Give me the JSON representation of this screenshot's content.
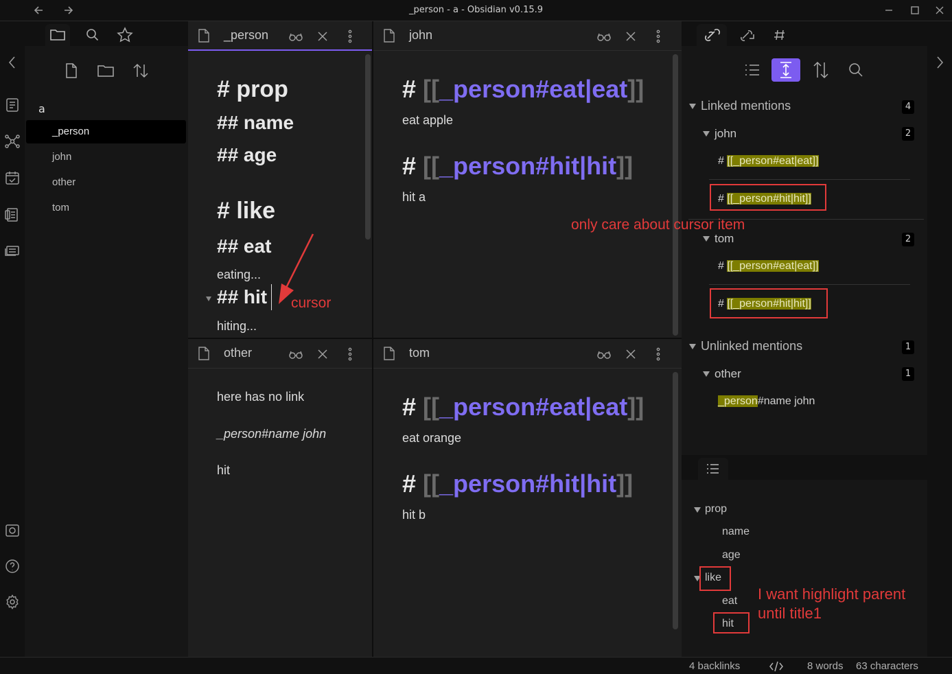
{
  "window": {
    "title": "_person - a - Obsidian v0.15.9"
  },
  "vault": {
    "name": "a"
  },
  "files": [
    "_person",
    "john",
    "other",
    "tom"
  ],
  "panes": {
    "person": {
      "tab_title": "_person",
      "h1_prop": "# prop",
      "h2_name": "## name",
      "h2_age": "## age",
      "h1_like": "# like",
      "h2_eat": "## eat",
      "eat_text": "eating...",
      "h2_hit": "## hit",
      "hit_text": "hiting..."
    },
    "john": {
      "tab_title": "john",
      "heading1": {
        "hash": "#",
        "open": "[[",
        "link": "_person#eat|eat",
        "close": "]]"
      },
      "text1": "eat apple",
      "heading2": {
        "hash": "#",
        "open": "[[",
        "link": "_person#hit|hit",
        "close": "]]"
      },
      "text2": "hit a"
    },
    "other": {
      "tab_title": "other",
      "line1": "here has no link",
      "line2": "_person#name john",
      "line3": "hit"
    },
    "tom": {
      "tab_title": "tom",
      "heading1": {
        "hash": "#",
        "open": "[[",
        "link": "_person#eat|eat",
        "close": "]]"
      },
      "text1": "eat orange",
      "heading2": {
        "hash": "#",
        "open": "[[",
        "link": "_person#hit|hit",
        "close": "]]"
      },
      "text2": "hit b"
    }
  },
  "backlinks": {
    "linked_label": "Linked mentions",
    "linked_count": "4",
    "john": {
      "name": "john",
      "count": "2",
      "hash": "#",
      "m1": "[[_person#eat|eat]]",
      "m2": "[[_person#hit|hit]]"
    },
    "tom": {
      "name": "tom",
      "count": "2",
      "hash": "#",
      "m1": "[[_person#eat|eat]]",
      "m2": "[[_person#hit|hit]]"
    },
    "unlinked_label": "Unlinked mentions",
    "unlinked_count": "1",
    "other": {
      "name": "other",
      "count": "1",
      "hl": "_person",
      "rest": "#name john"
    }
  },
  "outline": {
    "prop": "prop",
    "name": "name",
    "age": "age",
    "like": "like",
    "eat": "eat",
    "hit": "hit"
  },
  "annotations": {
    "cursor": "cursor",
    "cursor_item": "only care about cursor item",
    "highlight_1": "I want highlight parent",
    "highlight_2": "until title1"
  },
  "status": {
    "backlinks": "4 backlinks",
    "words": "8 words",
    "chars": "63 characters"
  },
  "colors": {
    "accent": "#7c5cf0",
    "link": "#7f6df2",
    "highlight": "#7d7d00",
    "annotation": "#e23a3a"
  }
}
